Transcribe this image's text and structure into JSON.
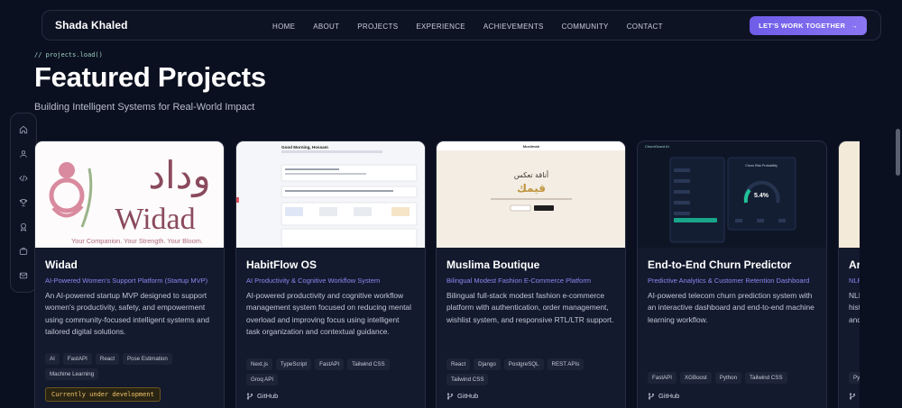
{
  "brand": "Shada Khaled",
  "nav": [
    "HOME",
    "ABOUT",
    "PROJECTS",
    "EXPERIENCE",
    "ACHIEVEMENTS",
    "COMMUNITY",
    "CONTACT"
  ],
  "cta": "LET'S WORK TOGETHER",
  "cta_arrow": "→",
  "comment": "// projects.load()",
  "title": "Featured Projects",
  "subtitle": "Building Intelligent Systems for Real-World Impact",
  "side_icons": [
    "home-icon",
    "user-icon",
    "code-icon",
    "trophy-icon",
    "award-icon",
    "briefcase-icon",
    "mail-icon"
  ],
  "projects": [
    {
      "title": "Widad",
      "subtitle": "AI-Powered Women's Support Platform (Startup MVP)",
      "description": "An AI-powered startup MVP designed to support women's productivity, safety, and empowerment using community-focused intelligent systems and tailored digital solutions.",
      "tags": [
        "AI",
        "FastAPI",
        "React",
        "Pose Estimation",
        "Machine Learning"
      ],
      "badge": "Currently under development",
      "thumb_logo": "وداد",
      "thumb_name": "Widad",
      "thumb_tagline": "Your Companion. Your Strength. Your Bloom."
    },
    {
      "title": "HabitFlow OS",
      "subtitle": "AI Productivity & Cognitive Workflow System",
      "description": "AI-powered productivity and cognitive workflow management system focused on reducing mental overload and improving focus using intelligent task organization and contextual guidance.",
      "tags": [
        "Next.js",
        "TypeScript",
        "FastAPI",
        "Tailwind CSS",
        "Groq API"
      ],
      "github": "GitHub",
      "thumb_header": "Good Morning, Hossam"
    },
    {
      "title": "Muslima Boutique",
      "subtitle": "Bilingual Modest Fashion E-Commerce Platform",
      "description": "Bilingual full-stack modest fashion e-commerce platform with authentication, order management, wishlist system, and responsive RTL/LTR support.",
      "tags": [
        "React",
        "Django",
        "PostgreSQL",
        "REST APIs",
        "Tailwind CSS"
      ],
      "github": "GitHub",
      "thumb_brand": "Muslimah",
      "thumb_line1": "أناقة تعكس",
      "thumb_line2": "قيمك"
    },
    {
      "title": "End-to-End Churn Predictor",
      "subtitle": "Predictive Analytics & Customer Retention Dashboard",
      "description": "AI-powered telecom churn prediction system with an interactive dashboard and end-to-end machine learning workflow.",
      "tags": [
        "FastAPI",
        "XGBoost",
        "Python",
        "Tailwind CSS"
      ],
      "github": "GitHub",
      "thumb_header": "ChurnGuard AI",
      "thumb_panel": "Churn Risk Probability",
      "thumb_gauge": "5.4%"
    },
    {
      "title": "Ar",
      "subtitle": "NLP",
      "description_lines": [
        "NLI",
        "hist",
        "and"
      ],
      "tags": [
        "Py"
      ],
      "github": "G"
    }
  ]
}
